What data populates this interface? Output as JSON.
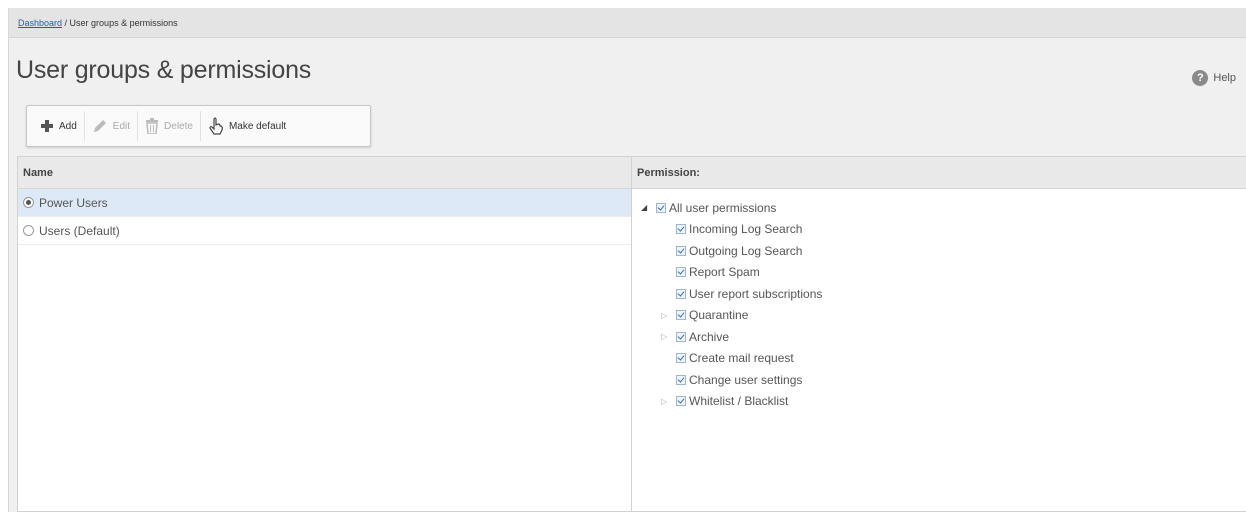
{
  "breadcrumb": {
    "link": "Dashboard",
    "separator": " / ",
    "current": "User groups & permissions"
  },
  "page": {
    "title": "User groups & permissions"
  },
  "help": {
    "icon": "?",
    "label": "Help"
  },
  "toolbar": {
    "add_label": "Add",
    "edit_label": "Edit",
    "delete_label": "Delete",
    "make_default_label": "Make default"
  },
  "groups": {
    "header": "Name",
    "items": [
      {
        "label": "Power Users",
        "selected": true
      },
      {
        "label": "Users (Default)",
        "selected": false
      }
    ]
  },
  "permissions": {
    "header": "Permission:",
    "tree": [
      {
        "label": "All user permissions",
        "level": 0,
        "arrow": "expanded",
        "checked": true
      },
      {
        "label": "Incoming Log Search",
        "level": 1,
        "arrow": "none",
        "checked": true
      },
      {
        "label": "Outgoing Log Search",
        "level": 1,
        "arrow": "none",
        "checked": true
      },
      {
        "label": "Report Spam",
        "level": 1,
        "arrow": "none",
        "checked": true
      },
      {
        "label": "User report subscriptions",
        "level": 1,
        "arrow": "none",
        "checked": true
      },
      {
        "label": "Quarantine",
        "level": 1,
        "arrow": "collapsed",
        "checked": true
      },
      {
        "label": "Archive",
        "level": 1,
        "arrow": "collapsed",
        "checked": true
      },
      {
        "label": "Create mail request",
        "level": 1,
        "arrow": "none",
        "checked": true
      },
      {
        "label": "Change user settings",
        "level": 1,
        "arrow": "none",
        "checked": true
      },
      {
        "label": "Whitelist / Blacklist",
        "level": 1,
        "arrow": "collapsed",
        "checked": true
      }
    ]
  },
  "colors": {
    "selected_row": "#dde9f7",
    "link": "#1f5fa8"
  }
}
